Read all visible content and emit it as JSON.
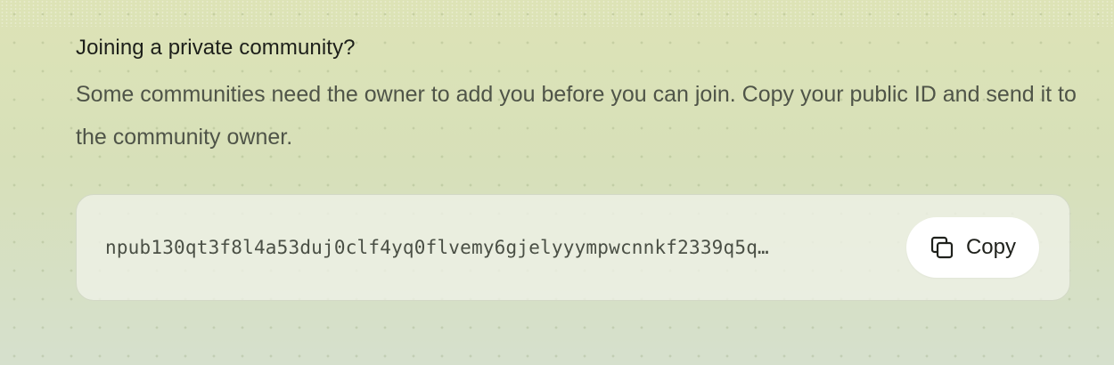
{
  "community_join": {
    "heading": "Joining a private community?",
    "description": "Some communities need the owner to add you before you can join. Copy your public ID and send it to the community owner.",
    "public_id": "npub130qt3f8l4a53duj0clf4yq0flvemy6gjelyyympwcnnkf2339q5q…",
    "copy_button_label": "Copy",
    "copy_icon": "copy-icon"
  }
}
